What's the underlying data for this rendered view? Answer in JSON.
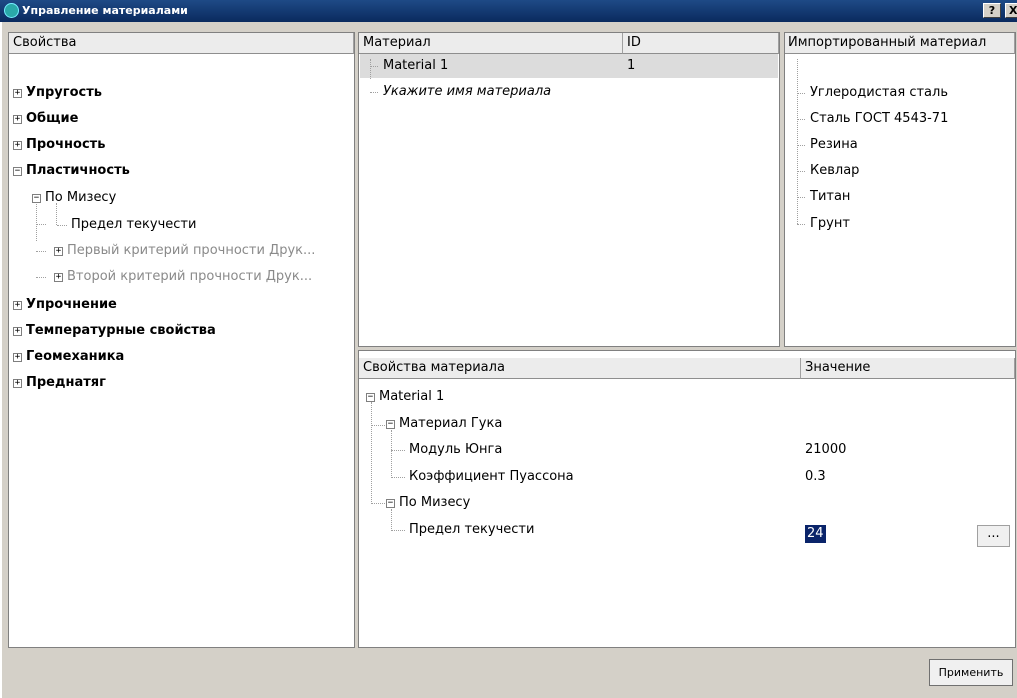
{
  "window": {
    "title": "Управление материалами",
    "help_label": "?",
    "close_label": "X"
  },
  "properties_panel": {
    "header": "Свойства",
    "items": [
      {
        "label": "Упругость",
        "toggle": "+"
      },
      {
        "label": "Общие",
        "toggle": "+"
      },
      {
        "label": "Прочность",
        "toggle": "+"
      },
      {
        "label": "Пластичность",
        "toggle": "−"
      },
      {
        "label": "По Мизесу",
        "toggle": "−"
      },
      {
        "label": "Предел текучести"
      },
      {
        "label": "Первый критерий прочности Друк...",
        "toggle": "+"
      },
      {
        "label": "Второй критерий прочности Друк...",
        "toggle": "+"
      },
      {
        "label": "Упрочнение",
        "toggle": "+"
      },
      {
        "label": "Температурные свойства",
        "toggle": "+"
      },
      {
        "label": "Геомеханика",
        "toggle": "+"
      },
      {
        "label": "Преднатяг",
        "toggle": "+"
      }
    ]
  },
  "materials_table": {
    "columns": [
      "Материал",
      "ID"
    ],
    "rows": [
      {
        "name": "Material 1",
        "id": "1"
      }
    ],
    "new_placeholder": "Укажите имя материала"
  },
  "imported_panel": {
    "header": "Импортированный материал",
    "items": [
      "Углеродистая сталь",
      "Сталь ГОСТ 4543-71",
      "Резина",
      "Кевлар",
      "Титан",
      "Грунт"
    ]
  },
  "material_props": {
    "columns": [
      "Свойства материала",
      "Значение"
    ],
    "rows": [
      {
        "label": "Material 1",
        "toggle": "−"
      },
      {
        "label": "Материал Гука",
        "toggle": "−"
      },
      {
        "label": "Модуль Юнга",
        "value": "21000"
      },
      {
        "label": "Коэффициент Пуассона",
        "value": "0.3"
      },
      {
        "label": "По Мизесу",
        "toggle": "−"
      },
      {
        "label": "Предел текучести",
        "value": "24"
      }
    ],
    "ellipsis_label": "..."
  },
  "footer": {
    "apply_label": "Применить"
  }
}
